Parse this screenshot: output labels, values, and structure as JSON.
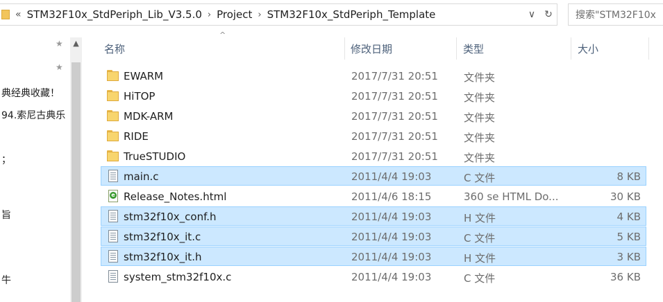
{
  "address_bar": {
    "overflow_chevron": "«",
    "breadcrumbs": [
      "STM32F10x_StdPeriph_Lib_V3.5.0",
      "Project",
      "STM32F10x_StdPeriph_Template"
    ],
    "dropdown_glyph": "∨",
    "refresh_glyph": "↻"
  },
  "search": {
    "placeholder": "搜索\"STM32F10x"
  },
  "nav_pane": {
    "pin_glyph": "★",
    "items": [
      "典经典收藏！",
      "94.索尼古典乐",
      "；",
      "旨",
      "牛"
    ]
  },
  "columns": {
    "name": "名称",
    "date": "修改日期",
    "type": "类型",
    "size": "大小",
    "sort_glyph": "^"
  },
  "files": [
    {
      "name": "EWARM",
      "date": "2017/7/31 20:51",
      "type": "文件夹",
      "size": "",
      "icon": "folder-icon",
      "selected": false
    },
    {
      "name": "HiTOP",
      "date": "2017/7/31 20:51",
      "type": "文件夹",
      "size": "",
      "icon": "folder-icon",
      "selected": false
    },
    {
      "name": "MDK-ARM",
      "date": "2017/7/31 20:51",
      "type": "文件夹",
      "size": "",
      "icon": "folder-icon",
      "selected": false
    },
    {
      "name": "RIDE",
      "date": "2017/7/31 20:51",
      "type": "文件夹",
      "size": "",
      "icon": "folder-icon",
      "selected": false
    },
    {
      "name": "TrueSTUDIO",
      "date": "2017/7/31 20:51",
      "type": "文件夹",
      "size": "",
      "icon": "folder-icon",
      "selected": false
    },
    {
      "name": "main.c",
      "date": "2011/4/4 19:03",
      "type": "C 文件",
      "size": "8 KB",
      "icon": "c-file-icon",
      "selected": true
    },
    {
      "name": "Release_Notes.html",
      "date": "2011/4/6 18:15",
      "type": "360 se HTML Do...",
      "size": "30 KB",
      "icon": "html-file-icon",
      "selected": false
    },
    {
      "name": "stm32f10x_conf.h",
      "date": "2011/4/4 19:03",
      "type": "H 文件",
      "size": "4 KB",
      "icon": "h-file-icon",
      "selected": true
    },
    {
      "name": "stm32f10x_it.c",
      "date": "2011/4/4 19:03",
      "type": "C 文件",
      "size": "5 KB",
      "icon": "c-file-icon",
      "selected": true
    },
    {
      "name": "stm32f10x_it.h",
      "date": "2011/4/4 19:03",
      "type": "H 文件",
      "size": "3 KB",
      "icon": "h-file-icon",
      "selected": true
    },
    {
      "name": "system_stm32f10x.c",
      "date": "2011/4/4 19:03",
      "type": "C 文件",
      "size": "36 KB",
      "icon": "c-file-icon",
      "selected": false
    }
  ],
  "colors": {
    "selection_bg": "#cce8ff",
    "selection_border": "#99d1ff",
    "folder": "#f8d56e",
    "header_text": "#4c607a"
  }
}
